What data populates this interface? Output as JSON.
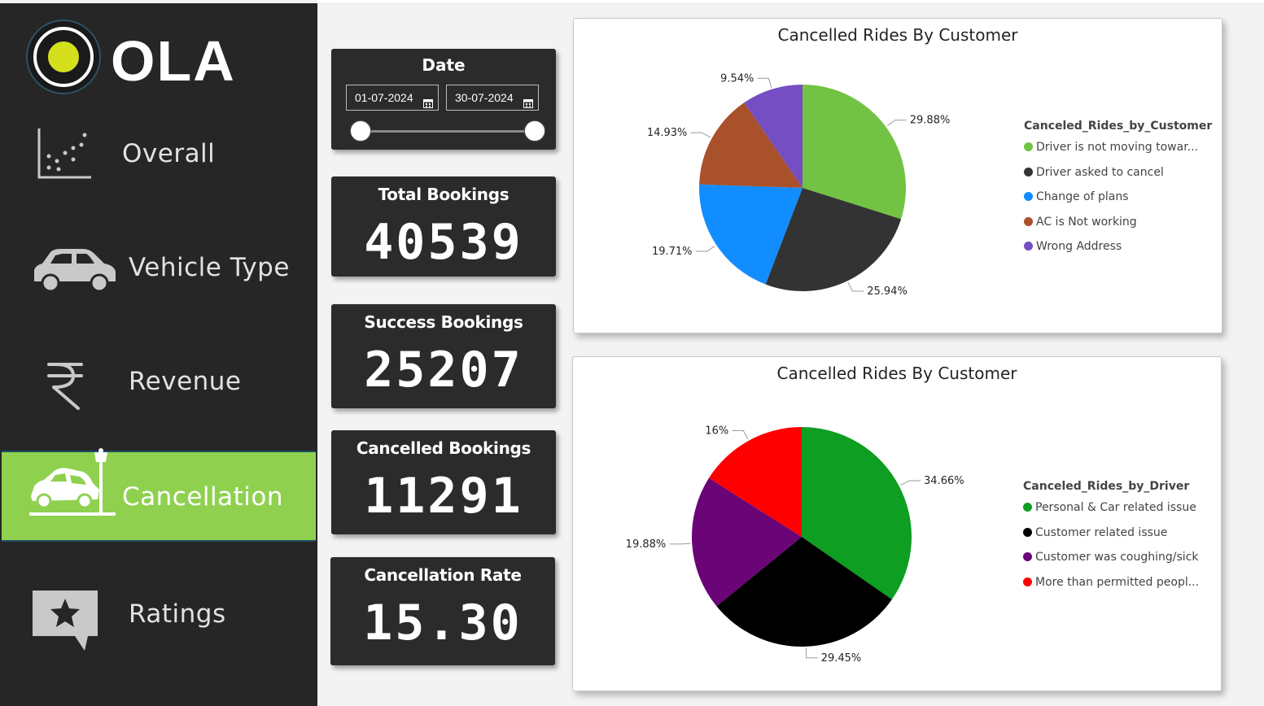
{
  "brand": {
    "name": "OLA"
  },
  "nav": {
    "items": [
      {
        "label": "Overall",
        "icon": "scatter-chart-icon",
        "active": false
      },
      {
        "label": "Vehicle Type",
        "icon": "car-icon",
        "active": false
      },
      {
        "label": "Revenue",
        "icon": "rupee-icon",
        "active": false
      },
      {
        "label": "Cancellation",
        "icon": "car-crash-icon",
        "active": true
      },
      {
        "label": "Ratings",
        "icon": "star-chat-icon",
        "active": false
      }
    ]
  },
  "date_filter": {
    "title": "Date",
    "start": "01-07-2024",
    "end": "30-07-2024",
    "range_start_fraction": 0,
    "range_end_fraction": 1
  },
  "kpis": [
    {
      "title": "Total Bookings",
      "value": "40539"
    },
    {
      "title": "Success Bookings",
      "value": "25207"
    },
    {
      "title": "Cancelled Bookings",
      "value": "11291"
    },
    {
      "title": "Cancellation Rate",
      "value": "15.30"
    }
  ],
  "colors": {
    "sidebar_bg": "#262626",
    "active_nav": "#8fd14f",
    "card_bg": "#2b2b2b"
  },
  "chart_data": [
    {
      "type": "pie",
      "title": "Cancelled Rides By Customer",
      "legend_title": "Canceled_Rides_by_Customer",
      "legend_position": "right",
      "slices": [
        {
          "name": "Driver is not moving towar...",
          "value": 29.88,
          "label": "29.88%",
          "color": "#72c343"
        },
        {
          "name": "Driver asked to cancel",
          "value": 25.94,
          "label": "25.94%",
          "color": "#333333"
        },
        {
          "name": "Change of plans",
          "value": 19.71,
          "label": "19.71%",
          "color": "#118dff"
        },
        {
          "name": "AC is Not working",
          "value": 14.93,
          "label": "14.93%",
          "color": "#a9512a"
        },
        {
          "name": "Wrong Address",
          "value": 9.54,
          "label": "9.54%",
          "color": "#744ec2"
        }
      ]
    },
    {
      "type": "pie",
      "title": "Cancelled Rides By Customer",
      "legend_title": "Canceled_Rides_by_Driver",
      "legend_position": "right",
      "slices": [
        {
          "name": "Personal & Car related issue",
          "value": 34.66,
          "label": "34.66%",
          "color": "#0e9e22"
        },
        {
          "name": "Customer related issue",
          "value": 29.45,
          "label": "29.45%",
          "color": "#000000"
        },
        {
          "name": "Customer was coughing/sick",
          "value": 19.88,
          "label": "19.88%",
          "color": "#6a0477"
        },
        {
          "name": "More than permitted peopl...",
          "value": 16,
          "label": "16%",
          "color": "#ff0000"
        }
      ]
    }
  ]
}
